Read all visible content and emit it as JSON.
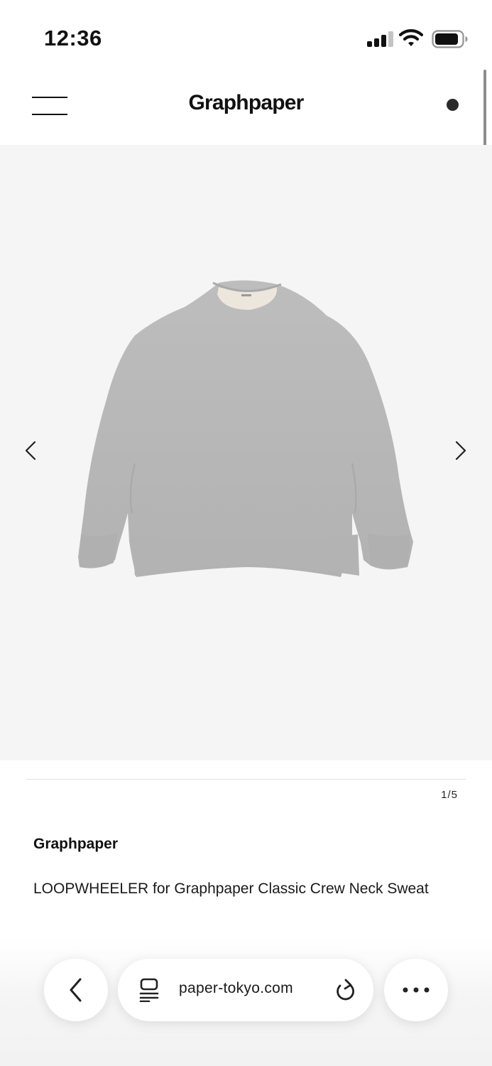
{
  "status_bar": {
    "time": "12:36"
  },
  "header": {
    "logo": "Graphpaper"
  },
  "gallery": {
    "image_alt": "Grey crew neck sweatshirt",
    "counter": "1/5"
  },
  "product": {
    "brand": "Graphpaper",
    "name": "LOOPWHEELER for Graphpaper Classic Crew Neck Sweat"
  },
  "browser": {
    "url": "paper-tokyo.com"
  },
  "colors": {
    "accent": "#111111",
    "gallery_bg": "#f5f5f5",
    "sweat_grey": "#b8b8b8"
  },
  "icons": [
    "signal-icon",
    "wifi-icon",
    "battery-icon",
    "menu-icon",
    "cart-icon",
    "chevron-left-icon",
    "chevron-right-icon",
    "back-icon",
    "tabs-icon",
    "reload-icon",
    "more-icon"
  ]
}
